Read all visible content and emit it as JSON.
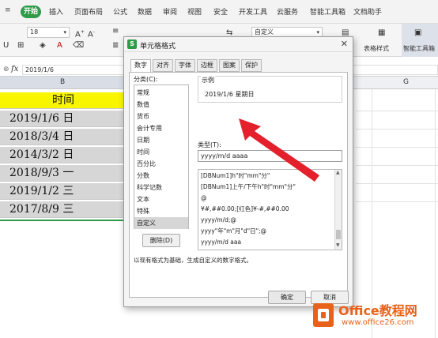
{
  "menubar": {
    "start": "开始",
    "items": [
      "插入",
      "页面布局",
      "公式",
      "数据",
      "审阅",
      "视图",
      "安全",
      "开发工具",
      "云服务",
      "智能工具箱",
      "文档助手"
    ]
  },
  "ribbon": {
    "font_size": "18",
    "format_box": "自定义",
    "table_style": "表格样式",
    "smart_toolbox": "智能工具箱"
  },
  "formula_bar": {
    "fx": "fx",
    "value": "2019/1/6"
  },
  "columns": {
    "b": "B",
    "g": "G"
  },
  "sheet": {
    "header": "时间",
    "rows": [
      "2019/1/6 日",
      "2018/3/4 日",
      "2014/3/2 日",
      "2018/9/3 一",
      "2019/1/2 三",
      "2017/8/9 三"
    ]
  },
  "dialog": {
    "title": "单元格格式",
    "tabs": [
      "数字",
      "对齐",
      "字体",
      "边框",
      "图案",
      "保护"
    ],
    "category_label": "分类(C):",
    "categories": [
      "常规",
      "数值",
      "货币",
      "会计专用",
      "日期",
      "时间",
      "百分比",
      "分数",
      "科学记数",
      "文本",
      "特殊",
      "自定义"
    ],
    "sample_label": "示例",
    "sample_value": "2019/1/6 星期日",
    "type_label": "类型(T):",
    "type_value": "yyyy/m/d aaaa",
    "type_list": [
      "[DBNum1]h\"时\"mm\"分\"",
      "[DBNum1]上午/下午h\"时\"mm\"分\"",
      "@",
      "¥#,##0.00;[红色]¥-#,##0.00",
      "yyyy/m/d;@",
      "yyyy\"年\"m\"月\"d\"日\";@",
      "yyyy/m/d aaa"
    ],
    "delete_button": "删除(D)",
    "description": "以现有格式为基础，生成自定义的数字格式。",
    "ok_button": "确定",
    "cancel_button": "取消"
  },
  "watermark": {
    "brand": "Office教程网",
    "url": "www.office26.com"
  },
  "colors": {
    "header_fill": "#f9f500",
    "data_fill": "#d6d6d6",
    "accent_green": "#2f9a48",
    "arrow_red": "#e3202b",
    "watermark_orange": "#e8621a"
  }
}
